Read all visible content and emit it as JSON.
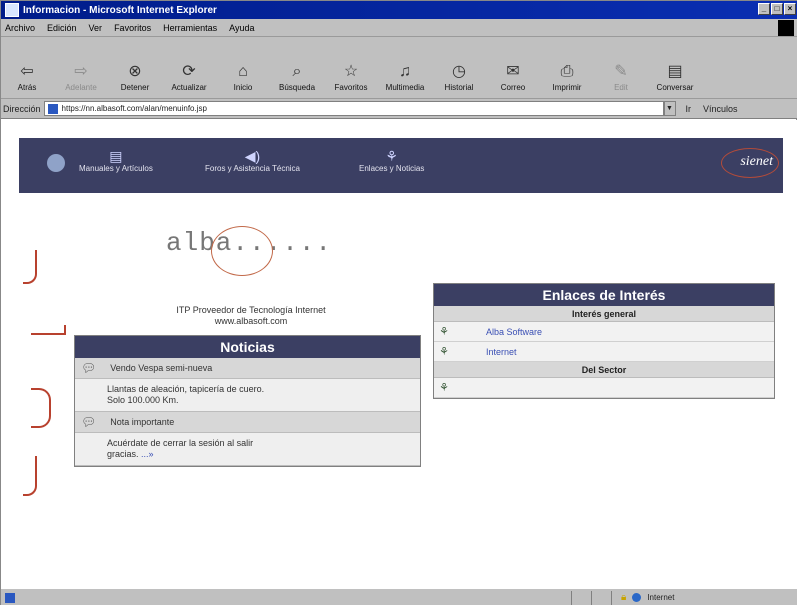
{
  "window": {
    "title": "Informacion - Microsoft Internet Explorer"
  },
  "menu": [
    "Archivo",
    "Edición",
    "Ver",
    "Favoritos",
    "Herramientas",
    "Ayuda"
  ],
  "toolbar": [
    {
      "label": "Atrás",
      "icon": "back-arrow-icon"
    },
    {
      "label": "Adelante",
      "icon": "forward-arrow-icon",
      "disabled": true
    },
    {
      "label": "Detener",
      "icon": "stop-icon"
    },
    {
      "label": "Actualizar",
      "icon": "refresh-icon"
    },
    {
      "label": "Inicio",
      "icon": "home-icon"
    },
    {
      "label": "Búsqueda",
      "icon": "search-icon"
    },
    {
      "label": "Favoritos",
      "icon": "favorites-icon"
    },
    {
      "label": "Multimedia",
      "icon": "multimedia-icon"
    },
    {
      "label": "Historial",
      "icon": "history-icon"
    },
    {
      "label": "Correo",
      "icon": "mail-icon"
    },
    {
      "label": "Imprimir",
      "icon": "print-icon"
    },
    {
      "label": "Edit",
      "icon": "edit-icon",
      "disabled": true
    },
    {
      "label": "Conversar",
      "icon": "discuss-icon"
    }
  ],
  "address": {
    "label": "Dirección",
    "value": "https://nn.albasoft.com/alan/menuinfo.jsp",
    "go": "Ir",
    "links": "Vínculos"
  },
  "banner": {
    "nav": [
      "Manuales y Artículos",
      "Foros y Asistencia Técnica",
      "Enlaces y Noticias"
    ],
    "brand": "sienet"
  },
  "logo": {
    "text": "alba......"
  },
  "company": {
    "line1": "ITP Proveedor de Tecnología Internet",
    "line2": "www.albasoft.com"
  },
  "noticias": {
    "header": "Noticias",
    "items": [
      {
        "title": "Vendo Vespa semi-nueva",
        "body": [
          "Llantas de aleación, tapicería de cuero.",
          "Solo 100.000 Km."
        ]
      },
      {
        "title": "Nota importante",
        "body": [
          "Acuérdate de cerrar la sesión al salir",
          "gracias."
        ],
        "more": "...»"
      }
    ]
  },
  "enlaces": {
    "header": "Enlaces de Interés",
    "sections": [
      {
        "title": "Interés general",
        "links": [
          "Alba Software",
          "Internet"
        ]
      },
      {
        "title": "Del Sector",
        "links": [
          ""
        ]
      }
    ]
  },
  "status": {
    "zone": "Internet"
  },
  "colors": {
    "banner": "#3b3f63",
    "accent_mark": "#b8412e",
    "link": "#3a4fb4"
  }
}
